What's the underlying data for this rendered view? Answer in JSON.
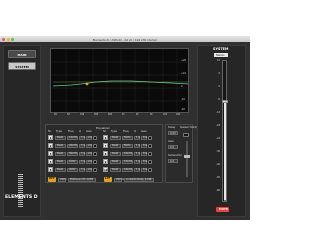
{
  "window": {
    "title": "Elements D / ASM-IO - 24 ch / 192 kHz (demo)"
  },
  "sidebar": {
    "buttons": [
      {
        "label": "MAIN",
        "active": false
      },
      {
        "label": "SYSTEM",
        "active": true
      }
    ],
    "brand": "ELEMENTS D"
  },
  "graph": {
    "y_labels": [
      "+20",
      "+10",
      "0",
      "-10",
      "-20"
    ],
    "x_labels": [
      "20",
      "50",
      "100",
      "200",
      "500",
      "1k",
      "2k",
      "5k",
      "10k",
      "20k"
    ],
    "curve_color": "#5fd0a0",
    "marker_color": "#e3a21a"
  },
  "equalizer": {
    "title": "Equalizer",
    "headers": [
      "Nr.",
      "Type",
      "Freq",
      "Q",
      "Gain"
    ],
    "left_bands": [
      {
        "num": "1",
        "type": "Peak",
        "freq": "100Hz",
        "q": "1.0",
        "gain": "0.0"
      },
      {
        "num": "2",
        "type": "Peak",
        "freq": "200Hz",
        "q": "1.0",
        "gain": "0.0"
      },
      {
        "num": "3",
        "type": "Peak",
        "freq": "500Hz",
        "q": "1.0",
        "gain": "0.0"
      },
      {
        "num": "4",
        "type": "Peak",
        "freq": "1kHz",
        "q": "1.0",
        "gain": "0.0"
      },
      {
        "num": "5",
        "type": "Peak",
        "freq": "2kHz",
        "q": "1.0",
        "gain": "0.0"
      }
    ],
    "right_bands": [
      {
        "num": "6",
        "type": "Peak",
        "freq": "5kHz",
        "q": "1.0",
        "gain": "0.0"
      },
      {
        "num": "7",
        "type": "Peak",
        "freq": "8kHz",
        "q": "1.0",
        "gain": "0.0"
      },
      {
        "num": "8",
        "type": "Peak",
        "freq": "10kHz",
        "q": "1.0",
        "gain": "0.0"
      },
      {
        "num": "9",
        "type": "Peak",
        "freq": "12kHz",
        "q": "1.0",
        "gain": "0.0"
      },
      {
        "num": "10",
        "type": "Peak",
        "freq": "16kHz",
        "q": "1.0",
        "gain": "0.0"
      }
    ],
    "hpf": {
      "label": "HPF",
      "freq": "20Hz",
      "type": "Butterworth 12dB"
    },
    "lpf": {
      "label": "LPF",
      "freq": "20kHz",
      "type": "Linkwitz-Riley 24dB"
    }
  },
  "controls": {
    "delay_label": "Delay",
    "delay_value": "0.00",
    "polarity_label": "Speaker Polarity",
    "gain_label": "Gain",
    "gain_value": "0.0",
    "subwoofer_label": "Subwoofer",
    "subwoofer_value": "0.0"
  },
  "right_panel": {
    "title": "SYSTEM",
    "selector": "Stereo",
    "scale": [
      "12",
      "6",
      "0",
      "-6",
      "-12",
      "-18",
      "-24",
      "-30",
      "-40",
      "-50",
      "-60"
    ],
    "mute_label": "MUTE"
  }
}
